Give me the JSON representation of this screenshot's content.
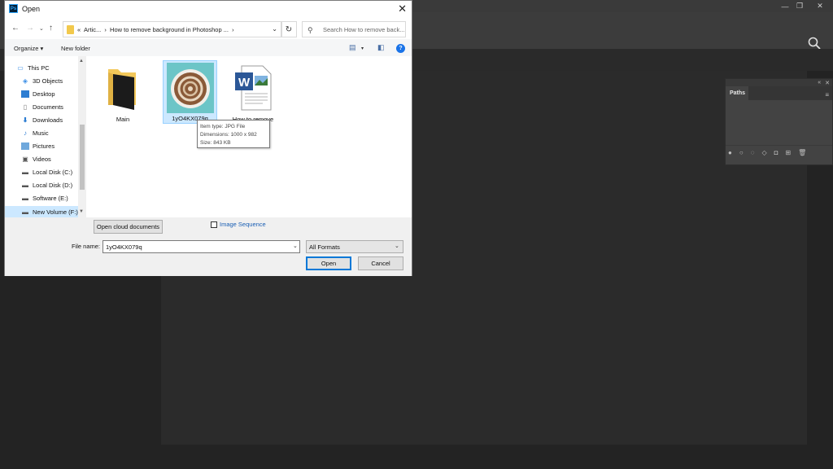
{
  "photoshop": {
    "window_controls": {
      "minimize": "—",
      "restore": "❐",
      "close": "✕"
    },
    "paths_panel": {
      "tab": "Paths",
      "collapse": "«",
      "close": "✕",
      "menu": "≡",
      "footer_icons": [
        "fill-path-icon",
        "stroke-path-icon",
        "load-selection-icon",
        "make-work-path-icon",
        "add-mask-icon",
        "new-path-icon",
        "delete-path-icon"
      ]
    }
  },
  "dialog": {
    "title": "Open",
    "app_badge": "Ps",
    "close": "✕",
    "address": {
      "prefix": "«",
      "crumbs": [
        "Artic...",
        "How to remove background in Photoshop ..."
      ],
      "sep": "›"
    },
    "search_placeholder": "Search How to remove back...",
    "toolbar": {
      "organize": "Organize ▾",
      "new_folder": "New folder",
      "help": "?"
    },
    "nav_items": [
      {
        "label": "This PC",
        "icon": "pc-icon"
      },
      {
        "label": "3D Objects",
        "icon": "3d-objects-icon"
      },
      {
        "label": "Desktop",
        "icon": "desktop-icon"
      },
      {
        "label": "Documents",
        "icon": "documents-icon"
      },
      {
        "label": "Downloads",
        "icon": "downloads-icon"
      },
      {
        "label": "Music",
        "icon": "music-icon"
      },
      {
        "label": "Pictures",
        "icon": "pictures-icon"
      },
      {
        "label": "Videos",
        "icon": "videos-icon"
      },
      {
        "label": "Local Disk (C:)",
        "icon": "drive-icon"
      },
      {
        "label": "Local Disk (D:)",
        "icon": "drive-icon"
      },
      {
        "label": "Software (E:)",
        "icon": "drive-icon"
      },
      {
        "label": "New Volume (F:)",
        "icon": "drive-icon"
      }
    ],
    "files": [
      {
        "name": "Main",
        "type": "folder"
      },
      {
        "name": "1yO4KX079q",
        "type": "image"
      },
      {
        "name": "How to remove",
        "type": "word"
      }
    ],
    "tooltip": {
      "type": "Item type: JPG File",
      "dimensions": "Dimensions: 1000 x 982",
      "size": "Size: 843 KB"
    },
    "open_cloud": "Open cloud documents",
    "image_sequence": "Image Sequence",
    "file_name_label": "File name:",
    "file_name_value": "1yO4KX079q",
    "format": "All Formats",
    "open_button": "Open",
    "cancel_button": "Cancel"
  }
}
